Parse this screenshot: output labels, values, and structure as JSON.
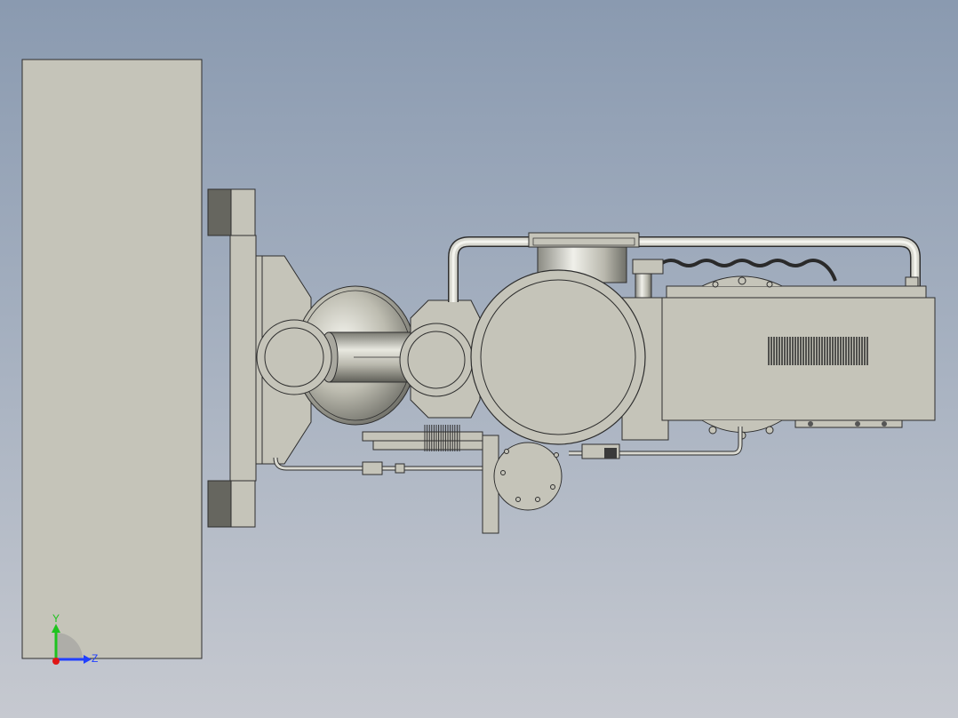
{
  "viewport": {
    "colors": {
      "background_top": "#8a9ab0",
      "background_bottom": "#c6c9d0",
      "part_fill": "#c5c4b9",
      "part_stroke": "#3a3a3a",
      "dark_block": "#66665f"
    }
  },
  "triad": {
    "y_label": "Y",
    "z_label": "Z",
    "y_color": "#1ec31e",
    "z_color": "#2140ff",
    "x_color": "#e01616"
  }
}
